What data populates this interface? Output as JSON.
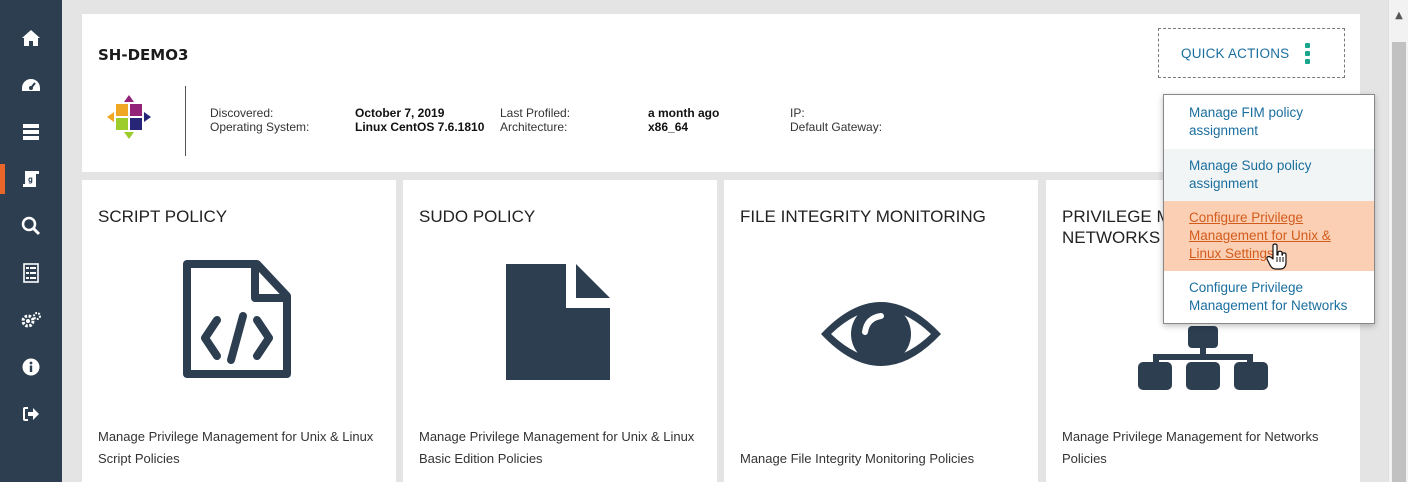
{
  "sidebar": {
    "items": [
      {
        "icon": "home-icon"
      },
      {
        "icon": "dashboard-gauge-icon"
      },
      {
        "icon": "server-icon"
      },
      {
        "icon": "script-policy-icon",
        "active": true
      },
      {
        "icon": "search-icon"
      },
      {
        "icon": "list-icon"
      },
      {
        "icon": "gears-icon"
      },
      {
        "icon": "info-icon"
      },
      {
        "icon": "sign-out-icon"
      }
    ],
    "active_color": "#e9662b",
    "background": "#2c3e50"
  },
  "asset": {
    "name": "SH-DEMO3",
    "os_logo": "centos-logo",
    "fields": {
      "discovered_label": "Discovered:",
      "discovered_value": "October 7, 2019",
      "os_label": "Operating System:",
      "os_value": "Linux CentOS 7.6.1810",
      "last_profiled_label": "Last Profiled:",
      "last_profiled_value": "a month ago",
      "arch_label": "Architecture:",
      "arch_value": "x86_64",
      "ip_label": "IP:",
      "gateway_label": "Default Gateway:"
    }
  },
  "quick_actions": {
    "label": "QUICK ACTIONS",
    "icon": "vertical-ellipsis-icon",
    "accent": "#18a68f",
    "items": [
      {
        "label": "Manage FIM policy assignment"
      },
      {
        "label": "Manage Sudo policy assignment"
      },
      {
        "label": "Configure Privilege Management for Unix & Linux Settings",
        "hovered": true
      },
      {
        "label": "Configure Privilege Management for Networks"
      }
    ]
  },
  "cards": [
    {
      "title": "SCRIPT POLICY",
      "icon": "code-file-icon",
      "description": "Manage Privilege Management for Unix & Linux Script Policies"
    },
    {
      "title": "SUDO POLICY",
      "icon": "file-icon",
      "description": "Manage Privilege Management for Unix & Linux Basic Edition Policies"
    },
    {
      "title": "FILE INTEGRITY MONITORING",
      "icon": "eye-icon",
      "description": "Manage File Integrity Monitoring Policies"
    },
    {
      "title": "PRIVILEGE M\nNETWORKS",
      "icon": "sitemap-icon",
      "description": "Manage Privilege Management for Networks Policies"
    }
  ],
  "colors": {
    "link": "#1a6e9e",
    "hover_bg": "#fbcfb3",
    "hover_text": "#d35b1c",
    "icon_dark": "#2c3e50"
  }
}
